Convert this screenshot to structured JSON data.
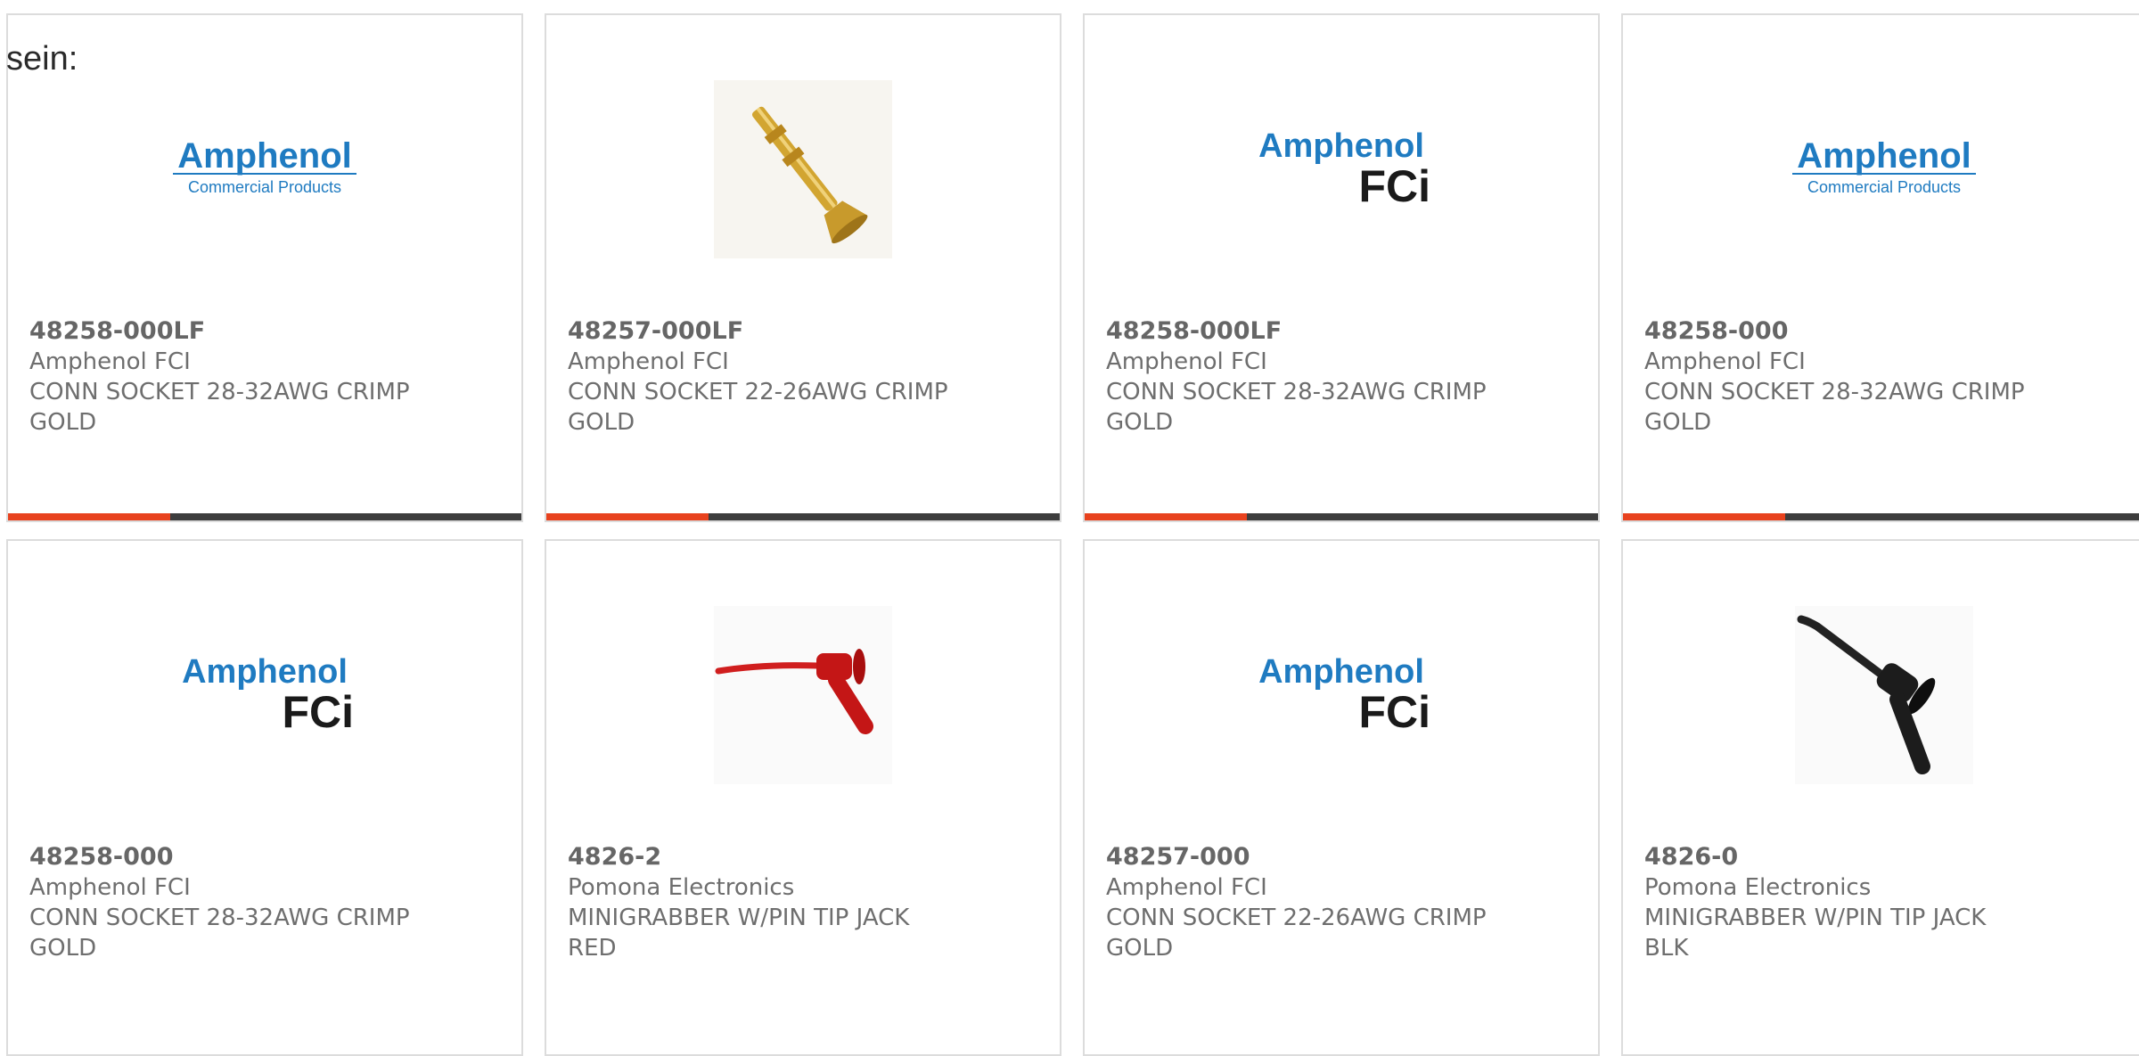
{
  "intro_text": "sein:",
  "colors": {
    "accent": "#e8421e",
    "bar_dark": "#3d3d3d",
    "text": "#666666"
  },
  "logos": {
    "commercial": {
      "word": "Amphenol",
      "sub": "Commercial Products"
    },
    "fci": {
      "word": "Amphenol",
      "sub": "FCi"
    }
  },
  "products": [
    {
      "part": "48258-000LF",
      "manufacturer": "Amphenol FCI",
      "description": "CONN SOCKET 28-32AWG CRIMP\nGOLD",
      "image": "amphenol-commercial-logo"
    },
    {
      "part": "48257-000LF",
      "manufacturer": "Amphenol FCI",
      "description": "CONN SOCKET 22-26AWG CRIMP\nGOLD",
      "image": "gold-crimp-pin"
    },
    {
      "part": "48258-000LF",
      "manufacturer": "Amphenol FCI",
      "description": "CONN SOCKET 28-32AWG CRIMP\nGOLD",
      "image": "amphenol-fci-logo"
    },
    {
      "part": "48258-000",
      "manufacturer": "Amphenol FCI",
      "description": "CONN SOCKET 28-32AWG CRIMP\nGOLD",
      "image": "amphenol-commercial-logo"
    },
    {
      "part": "48258-000",
      "manufacturer": "Amphenol FCI",
      "description": "CONN SOCKET 28-32AWG CRIMP\nGOLD",
      "image": "amphenol-fci-logo"
    },
    {
      "part": "4826-2",
      "manufacturer": "Pomona Electronics",
      "description": "MINIGRABBER W/PIN TIP JACK\nRED",
      "image": "red-minigrabber"
    },
    {
      "part": "48257-000",
      "manufacturer": "Amphenol FCI",
      "description": "CONN SOCKET 22-26AWG CRIMP\nGOLD",
      "image": "amphenol-fci-logo"
    },
    {
      "part": "4826-0",
      "manufacturer": "Pomona Electronics",
      "description": "MINIGRABBER W/PIN TIP JACK\nBLK",
      "image": "black-minigrabber"
    }
  ]
}
